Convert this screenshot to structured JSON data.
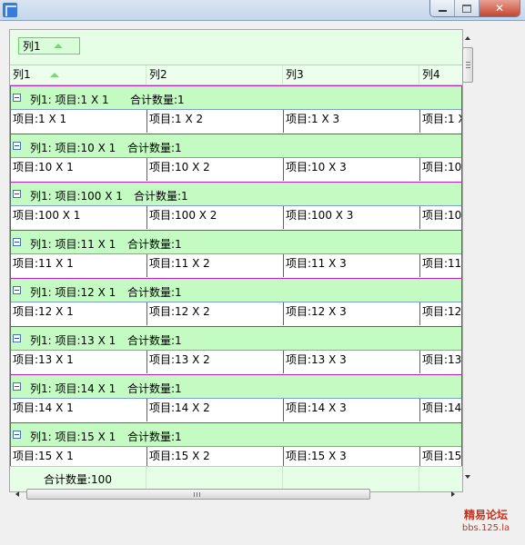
{
  "window": {
    "title": ""
  },
  "group_panel": {
    "chip_label": "列1"
  },
  "columns": [
    "列1",
    "列2",
    "列3",
    "列4"
  ],
  "groups": [
    {
      "title": "列1: 项目:1 X 1",
      "count": "合计数量:1",
      "cells": [
        "项目:1 X 1",
        "项目:1 X 2",
        "项目:1 X 3",
        "项目:1 X"
      ]
    },
    {
      "title": "列1: 项目:10 X 1",
      "count": "合计数量:1",
      "cells": [
        "项目:10 X 1",
        "项目:10 X 2",
        "项目:10 X 3",
        "项目:10"
      ]
    },
    {
      "title": "列1: 项目:100 X 1",
      "count": "合计数量:1",
      "cells": [
        "项目:100 X 1",
        "项目:100 X 2",
        "项目:100 X 3",
        "项目:10"
      ]
    },
    {
      "title": "列1: 项目:11 X 1",
      "count": "合计数量:1",
      "cells": [
        "项目:11 X 1",
        "项目:11 X 2",
        "项目:11 X 3",
        "项目:11"
      ]
    },
    {
      "title": "列1: 项目:12 X 1",
      "count": "合计数量:1",
      "cells": [
        "项目:12 X 1",
        "项目:12 X 2",
        "项目:12 X 3",
        "项目:12"
      ]
    },
    {
      "title": "列1: 项目:13 X 1",
      "count": "合计数量:1",
      "cells": [
        "项目:13 X 1",
        "项目:13 X 2",
        "项目:13 X 3",
        "项目:13"
      ]
    },
    {
      "title": "列1: 项目:14 X 1",
      "count": "合计数量:1",
      "cells": [
        "项目:14 X 1",
        "项目:14 X 2",
        "项目:14 X 3",
        "项目:14"
      ]
    },
    {
      "title": "列1: 项目:15 X 1",
      "count": "合计数量:1",
      "cells": [
        "项目:15 X 1",
        "项目:15 X 2",
        "项目:15 X 3",
        "项目:15"
      ]
    }
  ],
  "footer": {
    "total": "合计数量:100"
  },
  "watermark": {
    "line1": "精易论坛",
    "line2": "bbs.125.la"
  },
  "colors": {
    "group_row": "#c3fbc3",
    "header": "#ecfeec",
    "grid_line": "#c020c0",
    "row_separator": "#7ea0d0"
  }
}
